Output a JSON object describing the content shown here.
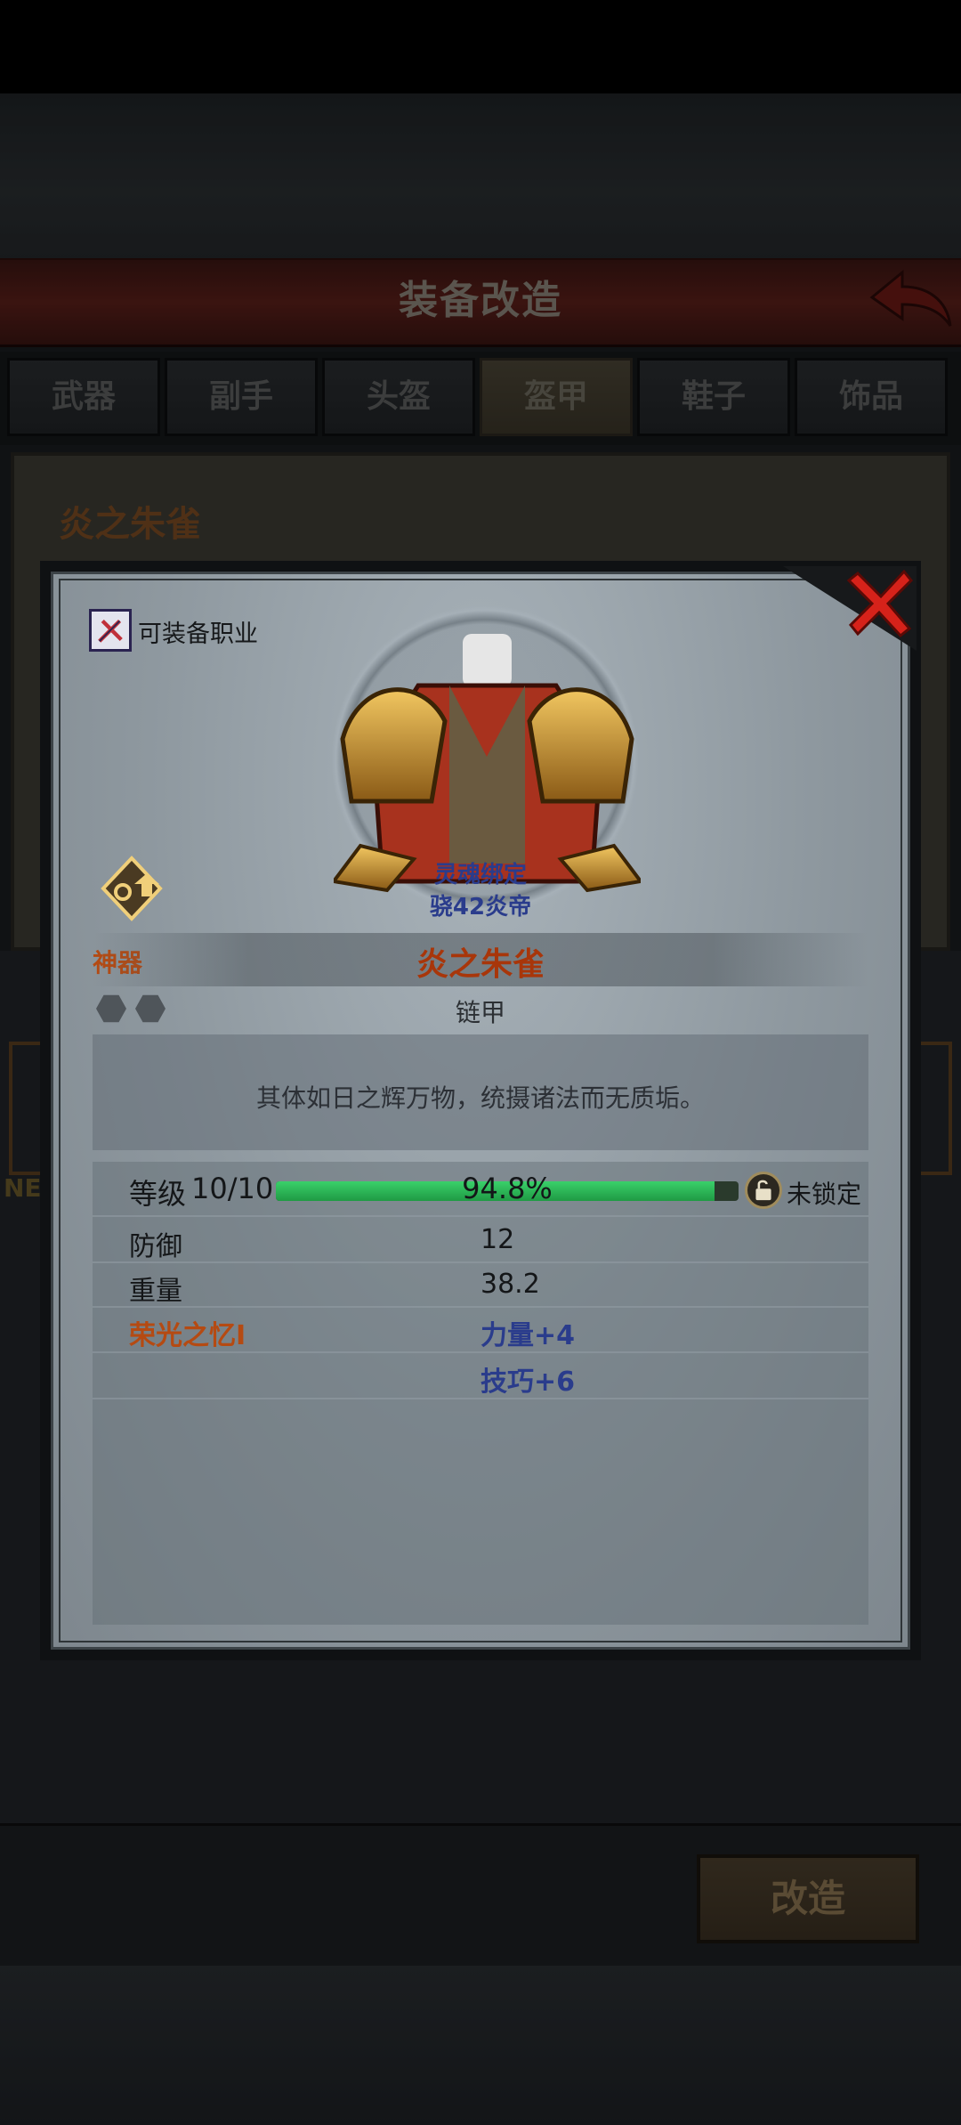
{
  "header": {
    "title": "装备改造"
  },
  "tabs": [
    {
      "label": "武器"
    },
    {
      "label": "副手"
    },
    {
      "label": "头盔"
    },
    {
      "label": "盔甲",
      "active": true
    },
    {
      "label": "鞋子"
    },
    {
      "label": "饰品"
    }
  ],
  "background_panel": {
    "item_name": "炎之朱雀",
    "side_text": "NE"
  },
  "footer": {
    "reforge_label": "改造"
  },
  "modal": {
    "job_label": "可装备职业",
    "artifact_label": "神器",
    "soul_bound": "灵魂绑定",
    "owner": "骁42炎帝",
    "item_name": "炎之朱雀",
    "item_type": "链甲",
    "description": "其体如日之辉万物，统摄诸法而无质垢。",
    "level": {
      "label": "等级",
      "value": "10/10",
      "progress_text": "94.8%",
      "progress": 0.948
    },
    "lock_label": "未锁定",
    "stats": [
      {
        "label": "防御",
        "value": "12"
      },
      {
        "label": "重量",
        "value": "38.2"
      }
    ],
    "glory": {
      "label": "荣光之忆I",
      "bonuses": [
        "力量+4",
        "技巧+6"
      ]
    }
  },
  "colors": {
    "accent_orange": "#b54a12",
    "bonus_blue": "#2a3c8c",
    "progress_green": "#2fbf5a",
    "close_red": "#d6221a"
  },
  "icons": {
    "back": "back-arrow-icon",
    "close": "close-icon",
    "job": "crossed-weapons-icon",
    "artifact": "upgrade-arrow-icon",
    "lock": "unlocked-padlock-icon"
  }
}
